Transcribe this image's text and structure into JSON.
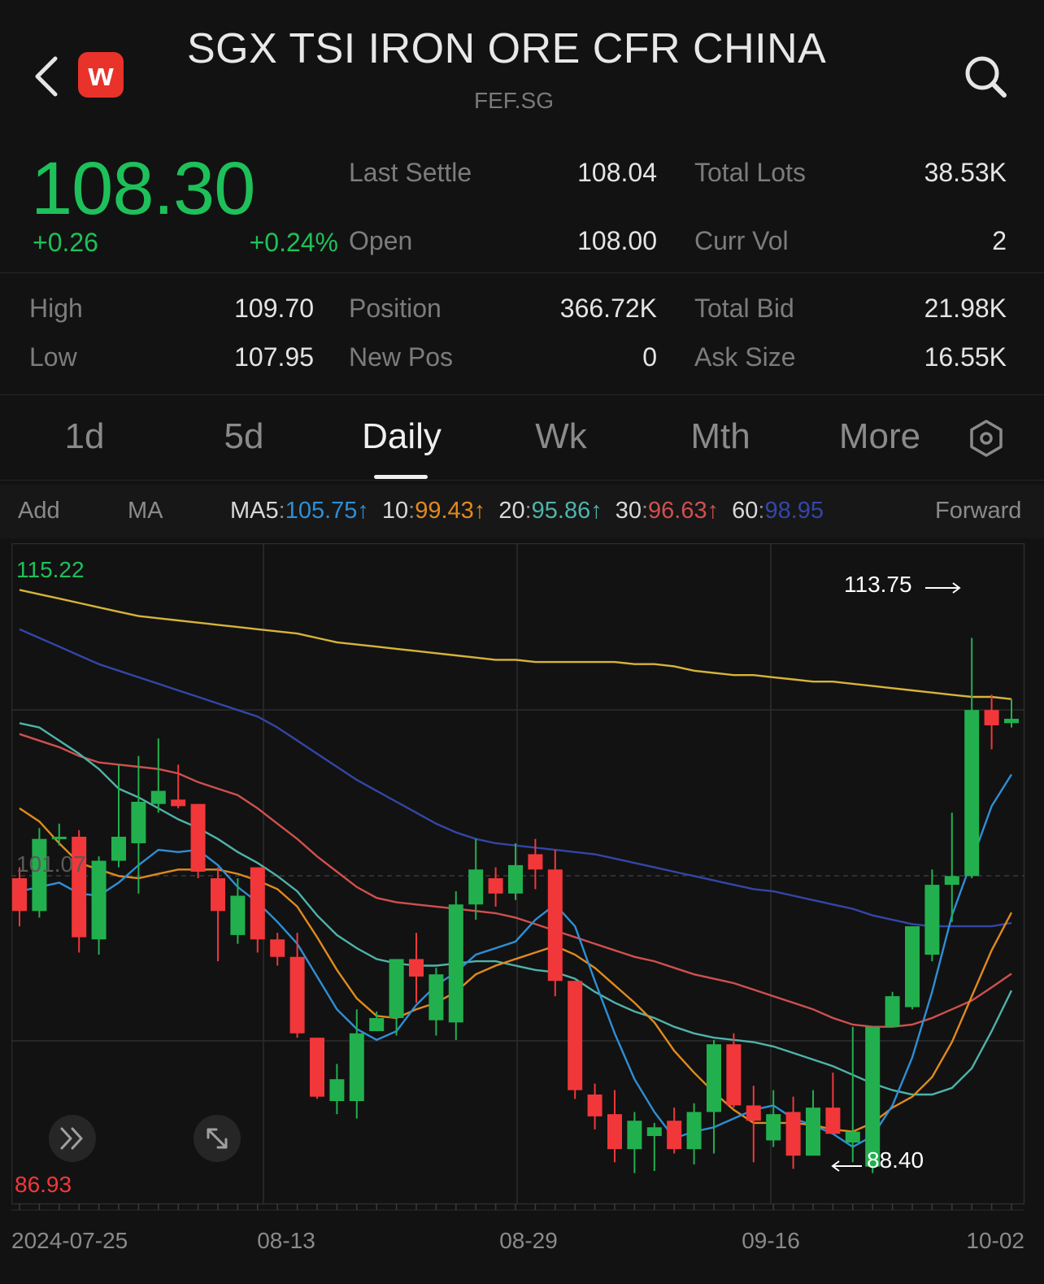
{
  "header": {
    "title": "SGX TSI IRON ORE CFR CHINA (6",
    "symbol": "FEF.SG",
    "logo_letter": "w",
    "icons": [
      "back-icon",
      "search-icon"
    ]
  },
  "quote": {
    "price": "108.30",
    "change": "+0.26",
    "change_pct": "+0.24%",
    "color_up": "#1ec05a",
    "stats": [
      {
        "label": "Last Settle",
        "value": "108.04"
      },
      {
        "label": "Total Lots",
        "value": "38.53K"
      },
      {
        "label": "Open",
        "value": "108.00"
      },
      {
        "label": "Curr Vol",
        "value": "2"
      },
      {
        "label": "High",
        "value": "109.70"
      },
      {
        "label": "Position",
        "value": "366.72K"
      },
      {
        "label": "Total Bid",
        "value": "21.98K"
      },
      {
        "label": "Low",
        "value": "107.95"
      },
      {
        "label": "New Pos",
        "value": "0"
      },
      {
        "label": "Ask Size",
        "value": "16.55K"
      }
    ]
  },
  "tabs": [
    "1d",
    "5d",
    "Daily",
    "Wk",
    "Mth",
    "More"
  ],
  "active_tab": "Daily",
  "indicators": {
    "add": "Add",
    "ma": "MA",
    "forward": "Forward",
    "ma_values": [
      {
        "label": "MA5",
        "sep": ":",
        "value": "105.75",
        "arrow": "↑",
        "color": "#2e8fd6"
      },
      {
        "label": "10",
        "sep": ":",
        "value": "99.43",
        "arrow": "↑",
        "color": "#e08a1e"
      },
      {
        "label": "20",
        "sep": ":",
        "value": "95.86",
        "arrow": "↑",
        "color": "#4fb3a9"
      },
      {
        "label": "30",
        "sep": ":",
        "value": "96.63",
        "arrow": "↑",
        "color": "#d0504e"
      },
      {
        "label": "60",
        "sep": ":",
        "value": "98.95",
        "arrow": "",
        "color": "#3346a8"
      }
    ]
  },
  "chart_data": {
    "type": "candlestick",
    "y_max_label": "115.22",
    "y_min_label": "86.93",
    "y_mid_label": "101.07",
    "ylim": [
      86.93,
      115.22
    ],
    "x_labels": [
      "2024-07-25",
      "08-13",
      "08-29",
      "09-16",
      "10-02"
    ],
    "max_annotation": "113.75",
    "min_annotation": "88.40",
    "up_color": "#22b04e",
    "down_color": "#f2373a",
    "candles": [
      [
        101.0,
        101.5,
        98.8,
        99.5
      ],
      [
        99.5,
        103.3,
        99.2,
        102.8
      ],
      [
        102.8,
        103.5,
        102.5,
        102.9
      ],
      [
        102.9,
        103.2,
        97.6,
        98.3
      ],
      [
        98.2,
        102.0,
        97.5,
        101.8
      ],
      [
        101.8,
        106.2,
        101.5,
        102.9
      ],
      [
        102.6,
        106.6,
        100.3,
        104.5
      ],
      [
        104.4,
        107.4,
        104.0,
        105.0
      ],
      [
        104.6,
        106.2,
        104.2,
        104.3
      ],
      [
        104.4,
        104.4,
        101.0,
        101.3
      ],
      [
        101.0,
        101.5,
        97.2,
        99.5
      ],
      [
        98.4,
        101.0,
        98.0,
        100.2
      ],
      [
        101.5,
        101.5,
        97.6,
        98.2
      ],
      [
        98.2,
        98.5,
        97.0,
        97.4
      ],
      [
        97.4,
        98.5,
        93.7,
        93.9
      ],
      [
        93.7,
        93.7,
        90.9,
        91.0
      ],
      [
        90.8,
        92.5,
        90.2,
        91.8
      ],
      [
        90.8,
        95.0,
        90.0,
        93.9
      ],
      [
        94.0,
        94.9,
        94.0,
        94.6
      ],
      [
        94.6,
        97.0,
        93.8,
        97.3
      ],
      [
        97.3,
        98.5,
        95.3,
        96.5
      ],
      [
        94.5,
        96.9,
        93.8,
        96.6
      ],
      [
        94.4,
        100.4,
        93.6,
        99.8
      ],
      [
        99.8,
        102.8,
        99.1,
        101.4
      ],
      [
        101.0,
        101.5,
        99.7,
        100.3
      ],
      [
        100.3,
        102.6,
        100.0,
        101.6
      ],
      [
        102.1,
        102.8,
        100.5,
        101.4
      ],
      [
        101.4,
        102.3,
        95.6,
        96.3
      ],
      [
        96.3,
        96.3,
        90.9,
        91.3
      ],
      [
        91.1,
        91.6,
        89.5,
        90.1
      ],
      [
        90.2,
        91.3,
        88.0,
        88.6
      ],
      [
        88.6,
        90.3,
        87.5,
        89.9
      ],
      [
        89.2,
        89.8,
        87.6,
        89.6
      ],
      [
        89.9,
        90.5,
        88.4,
        88.6
      ],
      [
        88.6,
        90.7,
        87.9,
        90.3
      ],
      [
        90.3,
        93.6,
        88.4,
        93.4
      ],
      [
        93.4,
        93.9,
        90.5,
        90.6
      ],
      [
        90.6,
        91.5,
        88.0,
        89.9
      ],
      [
        89.0,
        91.3,
        88.7,
        90.2
      ],
      [
        90.3,
        91.0,
        87.7,
        88.3
      ],
      [
        88.3,
        91.3,
        88.4,
        90.5
      ],
      [
        90.5,
        92.1,
        89.8,
        89.3
      ],
      [
        88.9,
        94.2,
        88.0,
        89.4
      ],
      [
        87.8,
        94.0,
        87.5,
        94.2
      ],
      [
        94.2,
        95.8,
        94.8,
        95.6
      ],
      [
        95.1,
        98.8,
        95.0,
        98.8
      ],
      [
        97.5,
        101.4,
        97.2,
        100.7
      ],
      [
        100.7,
        104.0,
        99.0,
        101.1
      ],
      [
        101.1,
        112.0,
        101.0,
        108.7
      ],
      [
        108.7,
        109.4,
        106.9,
        108.0
      ],
      [
        108.1,
        109.2,
        107.9,
        108.3
      ]
    ],
    "ma": [
      {
        "name": "MA5",
        "color": "#2e8fd6",
        "values": [
          100.4,
          100.6,
          100.8,
          100.3,
          100.2,
          100.8,
          101.6,
          102.3,
          102.2,
          102.3,
          101.6,
          100.6,
          99.9,
          99.0,
          98.0,
          96.5,
          95.0,
          94.1,
          93.6,
          94.0,
          95.2,
          96.1,
          96.7,
          97.5,
          97.8,
          98.1,
          99.1,
          99.8,
          98.8,
          96.3,
          93.9,
          91.8,
          90.3,
          89.1,
          89.4,
          89.6,
          90.0,
          90.4,
          90.6,
          90.0,
          89.7,
          89.3,
          88.7,
          89.2,
          90.6,
          92.8,
          95.8,
          99.3,
          101.8,
          104.3,
          105.75
        ]
      },
      {
        "name": "MA10",
        "color": "#e08a1e",
        "values": [
          104.2,
          103.6,
          102.6,
          101.7,
          101.4,
          101.1,
          101.0,
          101.2,
          101.4,
          101.4,
          101.4,
          101.2,
          100.9,
          100.5,
          99.7,
          98.3,
          96.8,
          95.5,
          94.7,
          94.6,
          95.0,
          95.3,
          95.8,
          96.6,
          97.0,
          97.3,
          97.6,
          97.9,
          97.5,
          96.9,
          96.1,
          95.3,
          94.4,
          93.1,
          92.1,
          91.2,
          90.4,
          89.8,
          89.8,
          89.8,
          89.7,
          89.5,
          89.4,
          89.8,
          90.5,
          91.0,
          91.9,
          93.5,
          95.6,
          97.7,
          99.43
        ]
      },
      {
        "name": "MA20",
        "color": "#4fb3a9",
        "values": [
          108.1,
          107.9,
          107.3,
          106.7,
          106.0,
          105.1,
          104.7,
          104.2,
          103.7,
          103.3,
          102.8,
          102.2,
          101.7,
          101.1,
          100.4,
          99.3,
          98.4,
          97.8,
          97.3,
          97.1,
          97.0,
          97.0,
          97.1,
          97.2,
          97.2,
          97.0,
          96.8,
          96.7,
          96.4,
          95.8,
          95.3,
          94.9,
          94.6,
          94.2,
          93.9,
          93.7,
          93.6,
          93.5,
          93.3,
          93.0,
          92.7,
          92.4,
          92.0,
          91.6,
          91.3,
          91.1,
          91.1,
          91.4,
          92.3,
          94.0,
          95.86
        ]
      },
      {
        "name": "MA30",
        "color": "#d0504e",
        "values": [
          107.6,
          107.3,
          107.0,
          106.6,
          106.3,
          106.2,
          106.1,
          106.0,
          105.8,
          105.4,
          105.1,
          104.8,
          104.2,
          103.5,
          102.8,
          102.0,
          101.3,
          100.6,
          100.1,
          99.9,
          99.8,
          99.7,
          99.6,
          99.5,
          99.4,
          99.2,
          98.9,
          98.6,
          98.3,
          98.0,
          97.7,
          97.4,
          97.2,
          96.9,
          96.6,
          96.4,
          96.2,
          95.9,
          95.6,
          95.3,
          95.0,
          94.6,
          94.3,
          94.2,
          94.2,
          94.3,
          94.6,
          95.0,
          95.4,
          96.0,
          96.63
        ]
      },
      {
        "name": "MA60",
        "color": "#3346a8",
        "values": [
          112.4,
          112.0,
          111.6,
          111.2,
          110.8,
          110.5,
          110.2,
          109.9,
          109.6,
          109.3,
          109.0,
          108.7,
          108.4,
          107.9,
          107.3,
          106.7,
          106.1,
          105.5,
          105.0,
          104.5,
          104.0,
          103.5,
          103.1,
          102.8,
          102.6,
          102.5,
          102.4,
          102.3,
          102.2,
          102.1,
          101.9,
          101.7,
          101.5,
          101.3,
          101.1,
          100.9,
          100.7,
          100.5,
          100.4,
          100.2,
          100.0,
          99.8,
          99.6,
          99.3,
          99.1,
          98.9,
          98.8,
          98.8,
          98.8,
          98.8,
          98.95
        ]
      },
      {
        "name": "MA120",
        "color": "#d6b43a",
        "values": [
          114.2,
          114.0,
          113.8,
          113.6,
          113.4,
          113.2,
          113.0,
          112.9,
          112.8,
          112.7,
          112.6,
          112.5,
          112.4,
          112.3,
          112.2,
          112.0,
          111.8,
          111.7,
          111.6,
          111.5,
          111.4,
          111.3,
          111.2,
          111.1,
          111.0,
          111.0,
          110.9,
          110.9,
          110.9,
          110.9,
          110.9,
          110.8,
          110.8,
          110.7,
          110.5,
          110.4,
          110.3,
          110.3,
          110.2,
          110.1,
          110.0,
          110.0,
          109.9,
          109.8,
          109.7,
          109.6,
          109.5,
          109.4,
          109.3,
          109.3,
          109.2
        ]
      }
    ],
    "grid": true
  },
  "chart_controls": {
    "icons": [
      "double-chevron-right-icon",
      "expand-icon"
    ]
  }
}
